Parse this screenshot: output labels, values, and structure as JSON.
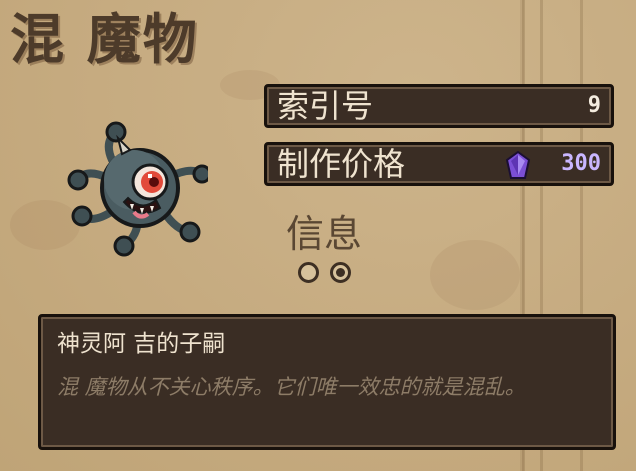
{
  "header": {
    "title": "混 魔物"
  },
  "stats": [
    {
      "label": "索引号",
      "value": "9"
    },
    {
      "label": "制作价格",
      "value": "300",
      "icon": "crystal-gem-icon",
      "icon_color": "#7b4fd6"
    }
  ],
  "info": {
    "title": "信息",
    "page_dots": 2,
    "active_dot": 2
  },
  "monster": {
    "icon": "chaos-beholder-monster-icon"
  },
  "description": {
    "title": "神灵阿 吉的子嗣",
    "body": "混 魔物从不关心秩序。它们唯一效忠的就是混乱。"
  },
  "colors": {
    "panel_bg": "#3a2d24",
    "panel_border": "#18110c",
    "parchment": "#c8ae84",
    "title_text": "#4d3b2a",
    "desc_text": "#8d7c67"
  }
}
